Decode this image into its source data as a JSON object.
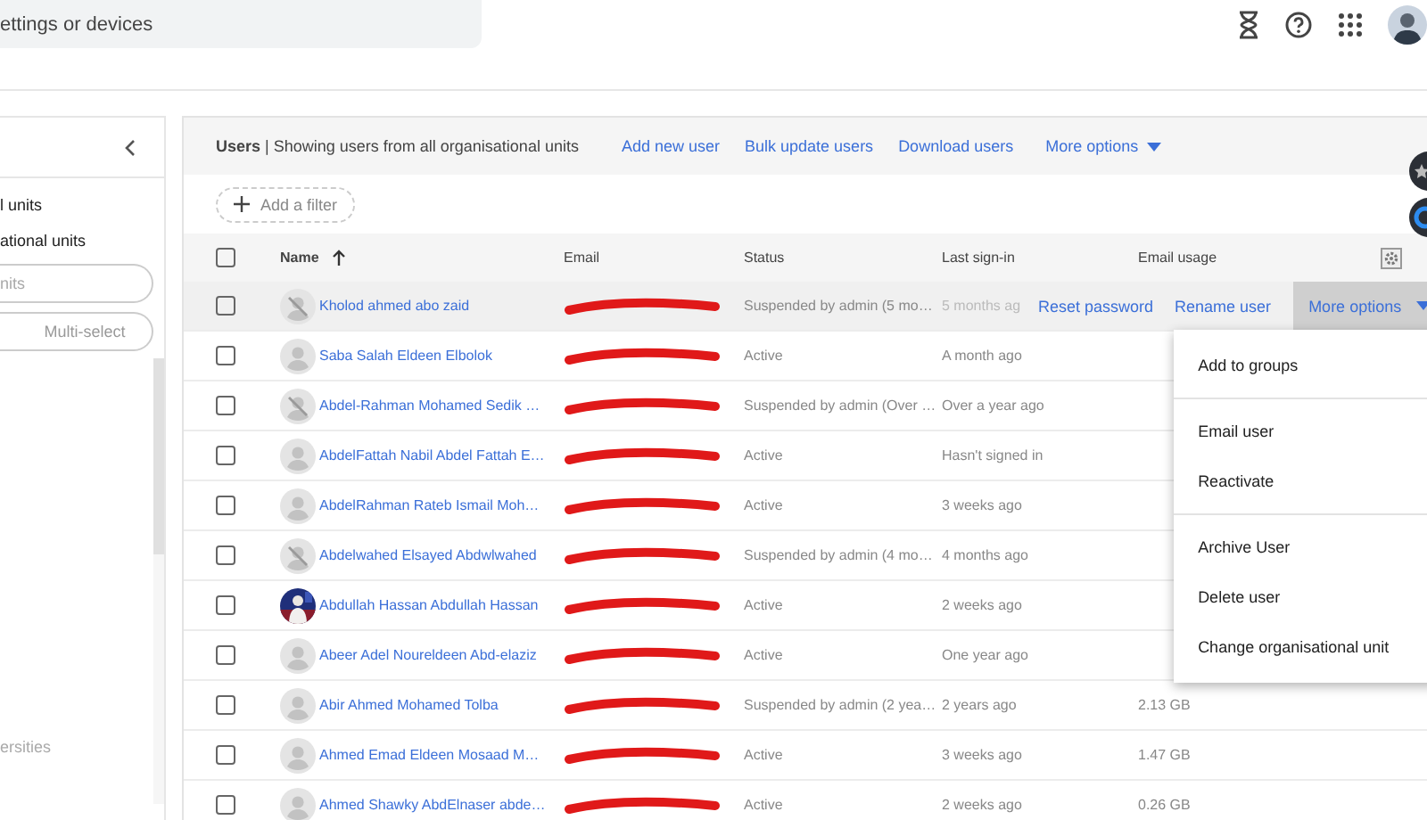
{
  "search": {
    "placeholder": "ettings or devices"
  },
  "sidebar": {
    "items": [
      "l units",
      "ational units"
    ],
    "field_placeholder": "nits",
    "multi_select": "Multi-select",
    "footer": "ersities"
  },
  "card": {
    "title": "**Users** | Showing users from all organisational units",
    "links": [
      "Add new user",
      "Bulk update users",
      "Download users"
    ],
    "more_options": "More options",
    "filter": "Add a filter",
    "columns": [
      "Name",
      "Email",
      "Status",
      "Last sign-in",
      "Email usage"
    ],
    "select_all_checked": false,
    "row_actions": {
      "links": [
        "Reset password",
        "Rename user"
      ],
      "menu_button": "More options"
    },
    "menu": [
      {
        "label": "Add to groups",
        "divider_before": false
      },
      {
        "label": "Email user",
        "divider_before": true
      },
      {
        "label": "Reactivate",
        "divider_before": false
      },
      {
        "label": "Archive User",
        "divider_before": true
      },
      {
        "label": "Delete user",
        "divider_before": false
      },
      {
        "label": "Change organisational unit",
        "divider_before": false
      }
    ],
    "rows": [
      {
        "name": "Kholod ahmed abo zaid",
        "kind": "suspended",
        "status": "Suspended by admin (5 mo…",
        "last_sign_in": "5 months ag",
        "checked": false,
        "hovered": true
      },
      {
        "name": "Saba Salah Eldeen Elbolok",
        "kind": "person",
        "status": "Active",
        "last_sign_in": "A month ago",
        "checked": false,
        "hovered": false
      },
      {
        "name": "Abdel-Rahman Mohamed Sedik …",
        "kind": "suspended",
        "status": "Suspended by admin (Over …",
        "last_sign_in": "Over a year ago",
        "checked": false,
        "hovered": false
      },
      {
        "name": "AbdelFattah Nabil Abdel Fattah E…",
        "kind": "person",
        "status": "Active",
        "last_sign_in": "Hasn't signed in",
        "checked": false,
        "hovered": false
      },
      {
        "name": "AbdelRahman Rateb Ismail Moh…",
        "kind": "person",
        "status": "Active",
        "last_sign_in": "3 weeks ago",
        "checked": false,
        "hovered": false
      },
      {
        "name": "Abdelwahed Elsayed Abdwlwahed",
        "kind": "suspended",
        "status": "Suspended by admin (4 mo…",
        "last_sign_in": "4 months ago",
        "checked": false,
        "hovered": false
      },
      {
        "name": "Abdullah Hassan Abdullah Hassan",
        "status": "Active",
        "last_sign_in": "2 weeks ago",
        "checked": false,
        "hovered": false
      },
      {
        "name": "Abeer Adel Noureldeen Abd-elaziz",
        "kind": "person",
        "status": "Active",
        "last_sign_in": "One year ago",
        "checked": false,
        "hovered": false
      },
      {
        "name": "Abir Ahmed Mohamed Tolba",
        "kind": "person",
        "status": "Suspended by admin (2 yea…",
        "last_sign_in": "2 years ago",
        "usage": "2.13 GB",
        "checked": false,
        "hovered": false
      },
      {
        "name": "Ahmed Emad Eldeen Mosaad M…",
        "kind": "person",
        "status": "Active",
        "last_sign_in": "3 weeks ago",
        "usage": "1.47 GB",
        "checked": false,
        "hovered": false
      },
      {
        "name": "Ahmed Shawky AbdElnaser abde…",
        "kind": "person",
        "status": "Active",
        "last_sign_in": "2 weeks ago",
        "usage": "0.26 GB",
        "checked": false,
        "hovered": false
      }
    ]
  }
}
